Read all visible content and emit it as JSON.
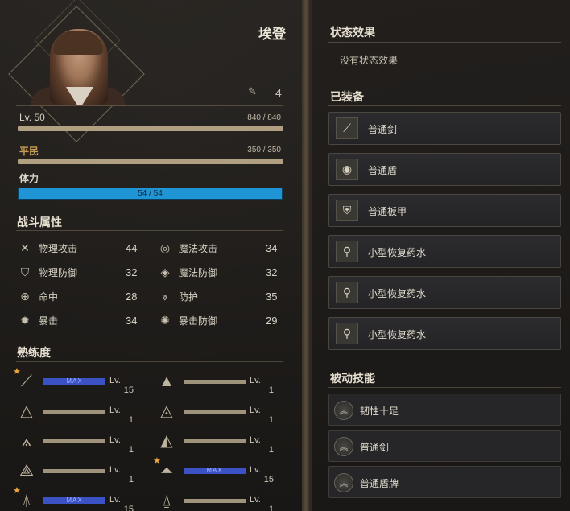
{
  "character": {
    "name": "埃登",
    "bag_count": "4"
  },
  "bars": {
    "level": {
      "label": "Lv. 50",
      "value": "840 / 840",
      "fraction": 1.0
    },
    "class": {
      "label": "平民",
      "value": "350 / 350",
      "fraction": 1.0
    },
    "stamina": {
      "label": "体力",
      "value": "54 / 54",
      "fraction": 1.0
    }
  },
  "combat": {
    "title": "战斗属性",
    "stats": [
      {
        "label": "物理攻击",
        "value": "44",
        "icon": "crossed-swords-icon"
      },
      {
        "label": "魔法攻击",
        "value": "34",
        "icon": "magic-swirl-icon"
      },
      {
        "label": "物理防御",
        "value": "32",
        "icon": "shield-swords-icon"
      },
      {
        "label": "魔法防御",
        "value": "32",
        "icon": "magic-shield-icon"
      },
      {
        "label": "命中",
        "value": "28",
        "icon": "target-icon"
      },
      {
        "label": "防护",
        "value": "35",
        "icon": "chevron-shield-icon"
      },
      {
        "label": "暴击",
        "value": "34",
        "icon": "burst-icon"
      },
      {
        "label": "暴击防御",
        "value": "29",
        "icon": "burst-shield-icon"
      }
    ]
  },
  "proficiency": {
    "title": "熟练度",
    "lv_prefix": "Lv.",
    "max_label": "MAX",
    "items": [
      {
        "icon": "sword-triangle-icon",
        "starred": true,
        "max": true,
        "level": "15"
      },
      {
        "icon": "magic-triangle-icon",
        "starred": false,
        "max": false,
        "level": "1"
      },
      {
        "icon": "shield-triangle-icon",
        "starred": false,
        "max": false,
        "level": "1"
      },
      {
        "icon": "orb-triangle-icon",
        "starred": false,
        "max": false,
        "level": "1"
      },
      {
        "icon": "axe-triangle-icon",
        "starred": false,
        "max": false,
        "level": "1"
      },
      {
        "icon": "eye-triangle-icon",
        "starred": false,
        "max": false,
        "level": "1"
      },
      {
        "icon": "spear-triangle-icon",
        "starred": false,
        "max": false,
        "level": "1"
      },
      {
        "icon": "armor-triangle-icon",
        "starred": true,
        "max": true,
        "level": "15"
      },
      {
        "icon": "helm-triangle-icon",
        "starred": true,
        "max": true,
        "level": "15"
      },
      {
        "icon": "wand-triangle-icon",
        "starred": false,
        "max": false,
        "level": "1"
      }
    ]
  },
  "status": {
    "title": "状态效果",
    "empty_text": "没有状态效果"
  },
  "equipped": {
    "title": "已装备",
    "items": [
      {
        "label": "普通剑",
        "icon": "sword-icon"
      },
      {
        "label": "普通盾",
        "icon": "round-shield-icon"
      },
      {
        "label": "普通板甲",
        "icon": "plate-armor-icon"
      },
      {
        "label": "小型恢复药水",
        "icon": "potion-icon"
      },
      {
        "label": "小型恢复药水",
        "icon": "potion-icon"
      },
      {
        "label": "小型恢复药水",
        "icon": "potion-icon"
      }
    ]
  },
  "passive": {
    "title": "被动技能",
    "items": [
      {
        "label": "韧性十足",
        "icon": "chevron-up-icon"
      },
      {
        "label": "普通剑",
        "icon": "chevron-up-icon"
      },
      {
        "label": "普通盾牌",
        "icon": "chevron-up-icon"
      }
    ]
  },
  "colors": {
    "stamina": "#1f95d6",
    "max_bar": "#3b52c4",
    "star": "#e9a53b"
  }
}
